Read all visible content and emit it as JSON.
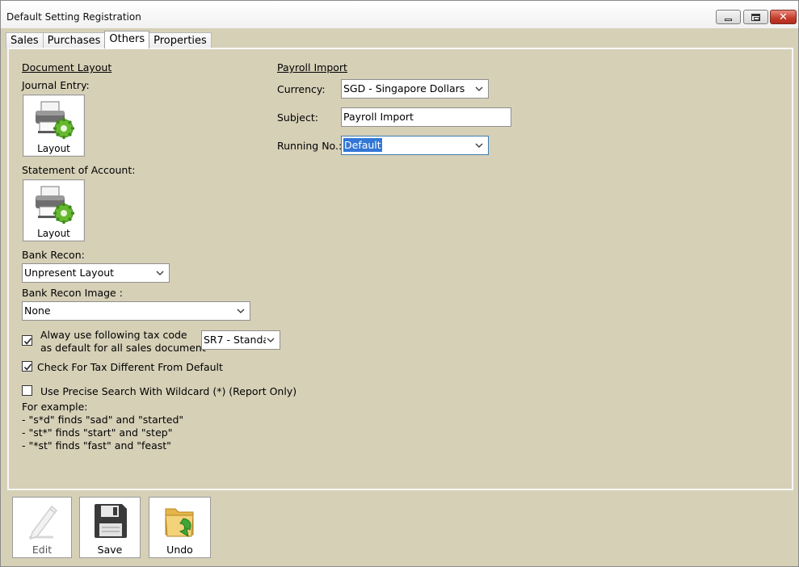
{
  "window": {
    "title": "Default Setting Registration"
  },
  "tabs": [
    {
      "label": "Sales"
    },
    {
      "label": "Purchases"
    },
    {
      "label": "Others",
      "active": true
    },
    {
      "label": "Properties"
    }
  ],
  "document_layout": {
    "heading": "Document Layout",
    "journal_entry_label": "Journal Entry:",
    "journal_entry_button": "Layout",
    "statement_label": "Statement of Account:",
    "statement_button": "Layout",
    "bank_recon_label": "Bank Recon:",
    "bank_recon_value": "Unpresent Layout",
    "bank_recon_image_label": "Bank Recon Image :",
    "bank_recon_image_value": "None"
  },
  "tax": {
    "always_tax_line1": "Alway use following tax code",
    "always_tax_line2": "as default for all sales document",
    "always_tax_checked": true,
    "tax_code_value": "SR7 - Standa",
    "check_tax_label": "Check For Tax Different From Default",
    "check_tax_checked": true
  },
  "search": {
    "precise_label": "Use Precise Search With Wildcard (*) (Report Only)",
    "precise_checked": false,
    "example_heading": "For example:",
    "examples": [
      "- \"s*d\" finds \"sad\" and \"started\"",
      "- \"st*\" finds \"start\" and \"step\"",
      "- \"*st\" finds \"fast\" and \"feast\""
    ]
  },
  "payroll": {
    "heading": "Payroll Import",
    "currency_label": "Currency:",
    "currency_value": "SGD - Singapore Dollars",
    "subject_label": "Subject:",
    "subject_value": "Payroll Import",
    "running_label": "Running No.:",
    "running_value": "Default"
  },
  "toolbar": {
    "edit_label": "Edit",
    "save_label": "Save",
    "undo_label": "Undo"
  }
}
